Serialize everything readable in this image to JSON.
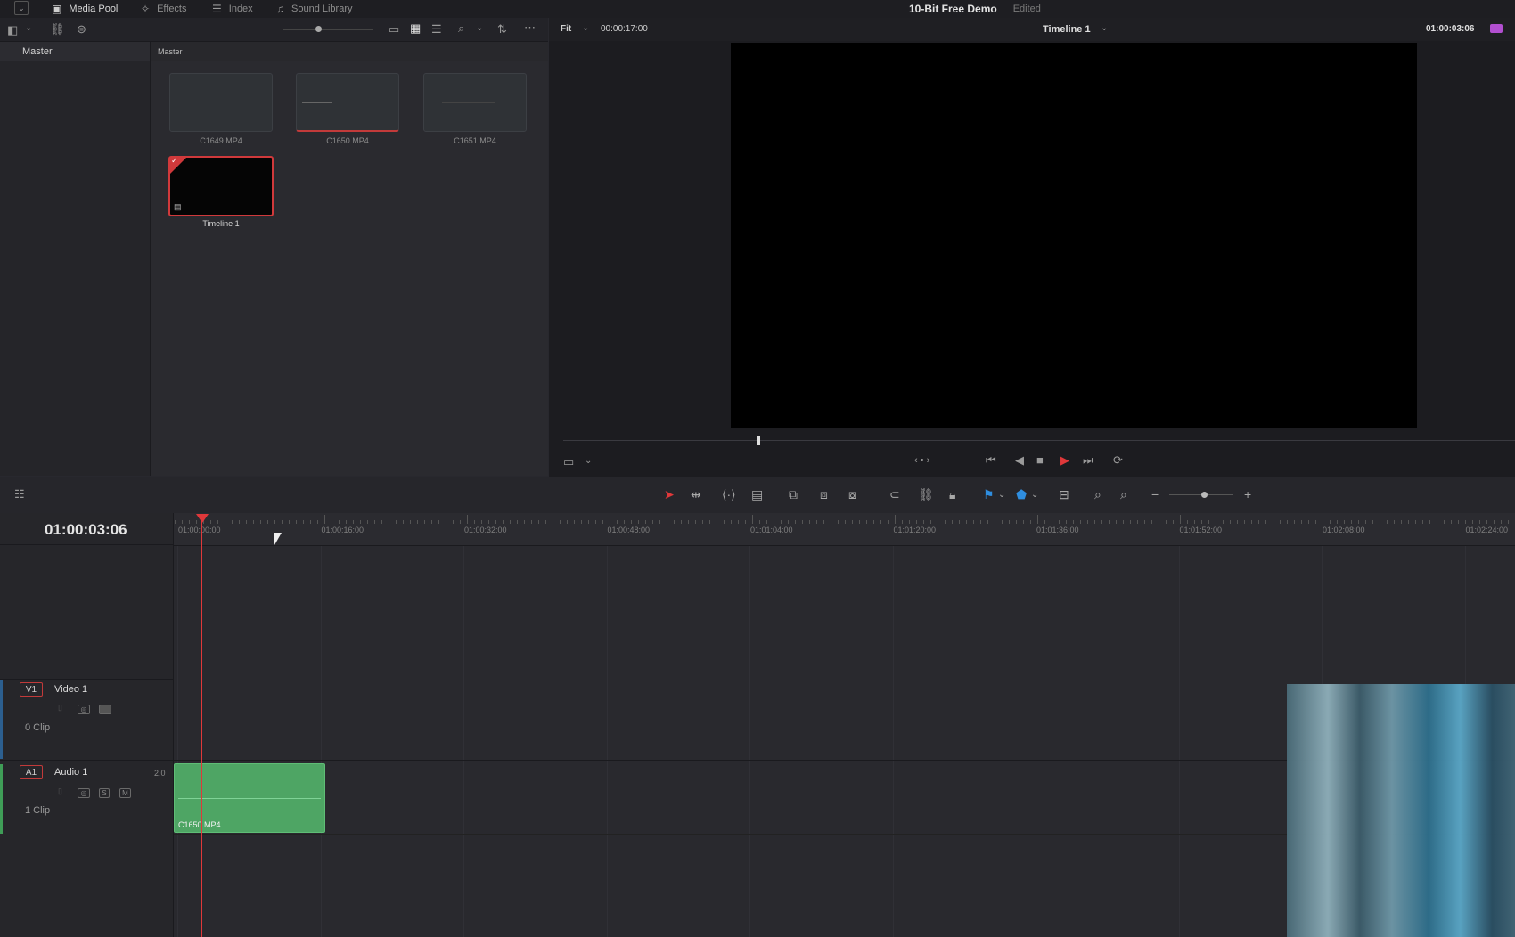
{
  "top_tabs": {
    "media_pool": "Media Pool",
    "effects": "Effects",
    "index": "Index",
    "sound_library": "Sound Library"
  },
  "project": {
    "title": "10-Bit Free Demo",
    "status": "Edited"
  },
  "media_pool": {
    "sidebar_title": "Master",
    "bin_title": "Master",
    "clips": [
      {
        "name": "C1649.MP4"
      },
      {
        "name": "C1650.MP4"
      },
      {
        "name": "C1651.MP4"
      },
      {
        "name": "Timeline 1"
      }
    ]
  },
  "viewer": {
    "zoom": "Fit",
    "source_timecode": "00:00:17:00",
    "timeline_name": "Timeline 1",
    "record_timecode": "01:00:03:06"
  },
  "timeline": {
    "current_timecode": "01:00:03:06",
    "ruler_labels": [
      "01:00:00:00",
      "01:00:16:00",
      "01:00:32:00",
      "01:00:48:00",
      "01:01:04:00",
      "01:01:20:00",
      "01:01:36:00",
      "01:01:52:00",
      "01:02:08:00",
      "01:02:24:00"
    ],
    "tracks": {
      "video": {
        "tag": "V1",
        "name": "Video 1",
        "clips": "0 Clip"
      },
      "audio": {
        "tag": "A1",
        "name": "Audio 1",
        "channels": "2.0",
        "clips": "1 Clip",
        "solo": "S",
        "mute": "M"
      }
    },
    "audio_clip": {
      "name": "C1650.MP4"
    }
  },
  "colors": {
    "accent_red": "#e0383a",
    "audio_clip_green": "#4ea564",
    "background": "#28282e"
  }
}
